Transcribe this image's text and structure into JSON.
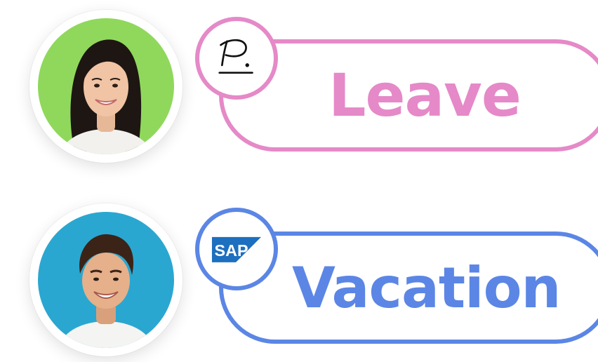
{
  "rows": [
    {
      "label": "Leave",
      "accent": "#e589c8",
      "avatar_bg": "#8fd85c",
      "badge_icon": "signature-p-icon"
    },
    {
      "label": "Vacation",
      "accent": "#5b86e5",
      "avatar_bg": "#2aa7d0",
      "badge_icon": "sap-logo-icon",
      "badge_logo_text": "SAP",
      "badge_logo_color": "#1d6fbf"
    }
  ]
}
